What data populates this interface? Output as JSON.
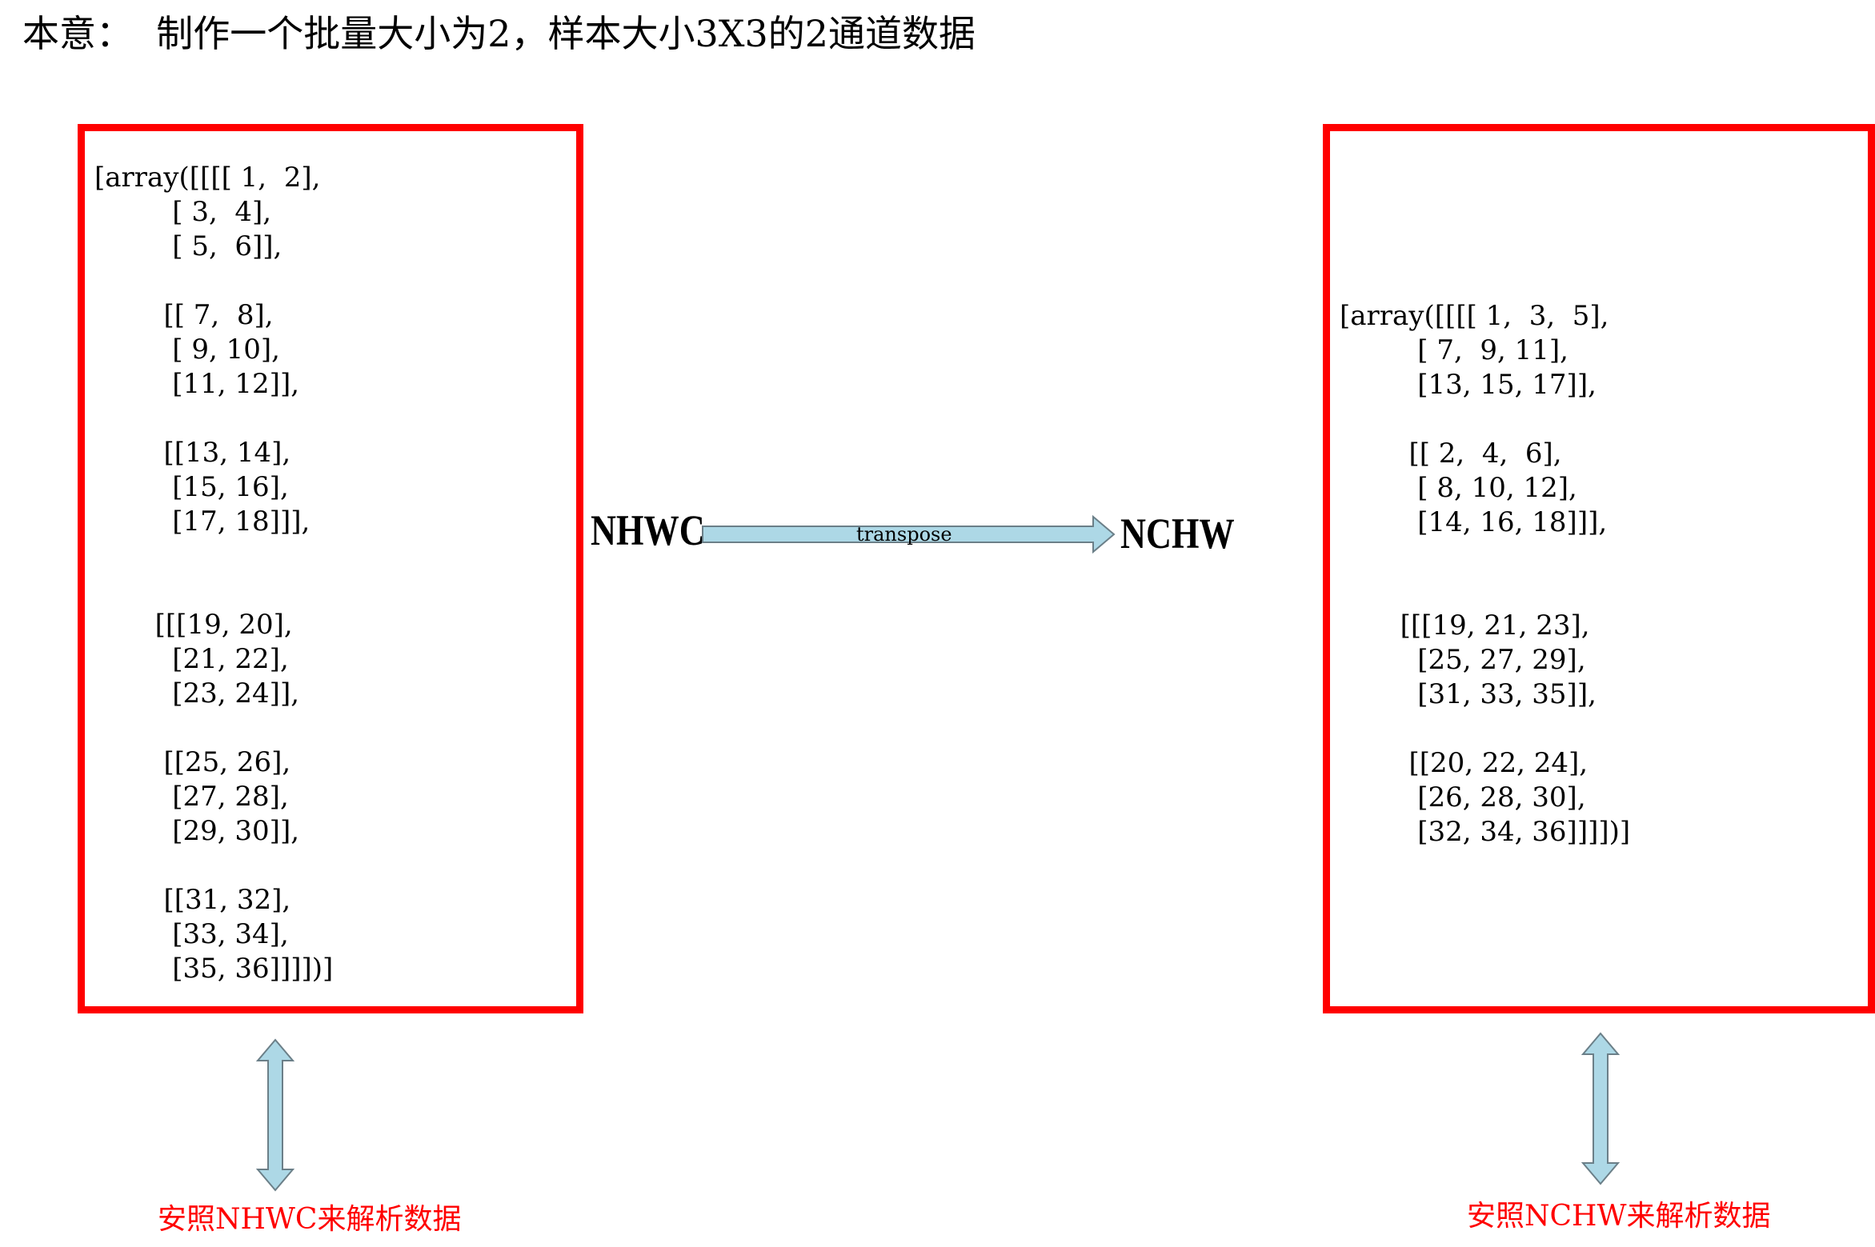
{
  "title": "本意：  制作一个批量大小为2，样本大小3X3的2通道数据",
  "left_panel": {
    "array_text": "[array([[[[ 1,  2],\n         [ 3,  4],\n         [ 5,  6]],\n\n        [[ 7,  8],\n         [ 9, 10],\n         [11, 12]],\n\n        [[13, 14],\n         [15, 16],\n         [17, 18]]],\n\n\n       [[[19, 20],\n         [21, 22],\n         [23, 24]],\n\n        [[25, 26],\n         [27, 28],\n         [29, 30]],\n\n        [[31, 32],\n         [33, 34],\n         [35, 36]]]])]",
    "caption": "安照NHWC来解析数据"
  },
  "right_panel": {
    "array_text": "[array([[[[ 1,  3,  5],\n         [ 7,  9, 11],\n         [13, 15, 17]],\n\n        [[ 2,  4,  6],\n         [ 8, 10, 12],\n         [14, 16, 18]]],\n\n\n       [[[19, 21, 23],\n         [25, 27, 29],\n         [31, 33, 35]],\n\n        [[20, 22, 24],\n         [26, 28, 30],\n         [32, 34, 36]]]])]",
    "caption": "安照NCHW来解析数据"
  },
  "transform": {
    "source_format": "NHWC",
    "target_format": "NCHW",
    "arrow_label": "transpose"
  },
  "colors": {
    "box_border": "#ff0000",
    "arrow_fill": "#add8e6",
    "caption_text": "#ff0000"
  }
}
